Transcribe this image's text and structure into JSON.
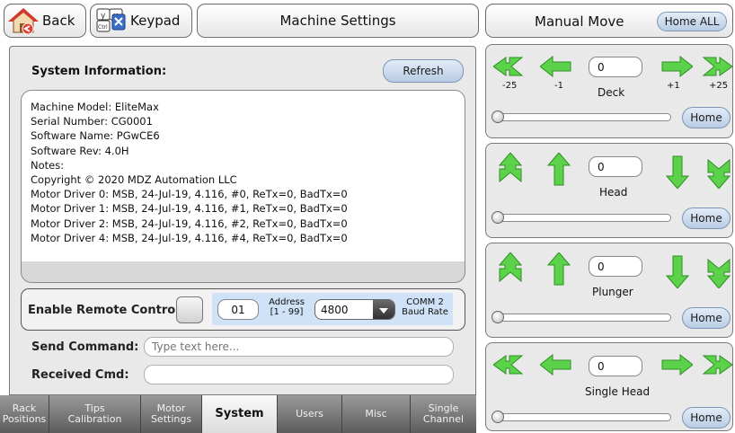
{
  "toolbar": {
    "back_label": "Back",
    "keypad_label": "Keypad",
    "title": "Machine Settings"
  },
  "manual": {
    "title": "Manual Move",
    "home_all_label": "Home ALL",
    "home_label": "Home",
    "axes": [
      {
        "name": "Deck",
        "value": "0",
        "labels": [
          "-25",
          "-1",
          "+1",
          "+25"
        ]
      },
      {
        "name": "Head",
        "value": "0"
      },
      {
        "name": "Plunger",
        "value": "0"
      },
      {
        "name": "Single Head",
        "value": "0"
      }
    ]
  },
  "system": {
    "title": "System Information:",
    "refresh_label": "Refresh",
    "info_lines": [
      "Machine Model: EliteMax",
      "Serial Number: CG0001",
      "Software Name: PGwCE6",
      "Software Rev: 4.0H",
      "Notes:",
      "Copyright © 2020 MDZ Automation LLC",
      "Motor Driver 0: MSB, 24-Jul-19, 4.116, #0, ReTx=0, BadTx=0",
      "Motor Driver 1: MSB, 24-Jul-19, 4.116, #1, ReTx=0, BadTx=0",
      "Motor Driver 2: MSB, 24-Jul-19, 4.116, #2, ReTx=0, BadTx=0",
      "Motor Driver 4: MSB, 24-Jul-19, 4.116, #4, ReTx=0, BadTx=0"
    ],
    "remote": {
      "label": "Enable Remote Control:",
      "address_value": "01",
      "address_label_1": "Address",
      "address_label_2": "[1 - 99]",
      "baud_value": "4800",
      "comm_label_1": "COMM 2",
      "comm_label_2": "Baud Rate"
    },
    "send_label": "Send Command:",
    "send_placeholder": "Type text here...",
    "received_label": "Received Cmd:"
  },
  "tabs": [
    {
      "line1": "Rack",
      "line2": "Positions"
    },
    {
      "line1": "Tips",
      "line2": "Calibration"
    },
    {
      "line1": "Motor",
      "line2": "Settings"
    },
    {
      "line1": "System",
      "line2": ""
    },
    {
      "line1": "Users",
      "line2": ""
    },
    {
      "line1": "Misc",
      "line2": ""
    },
    {
      "line1": "Single",
      "line2": "Channel"
    }
  ],
  "colors": {
    "arrow_green": "#5cd14a",
    "button_blue": "#c6d6ec",
    "remote_blue": "#cfe2f7"
  }
}
